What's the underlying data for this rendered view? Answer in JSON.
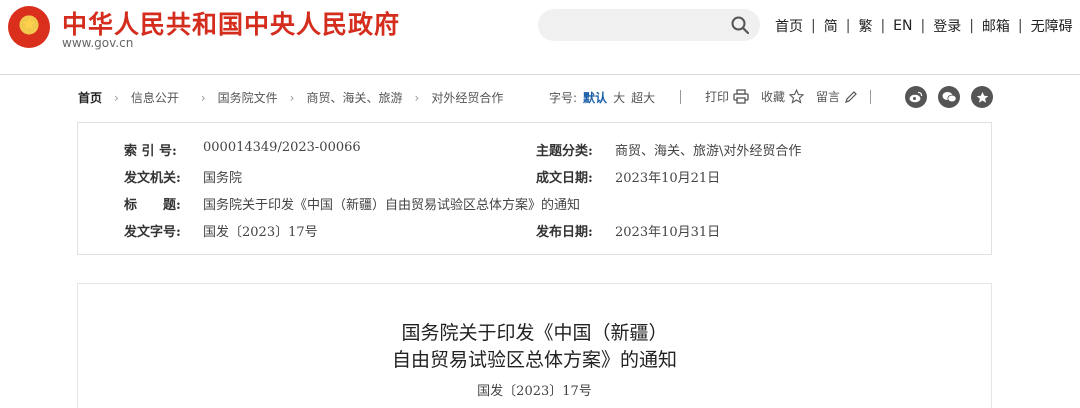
{
  "header": {
    "site_name": "中华人民共和国中央人民政府",
    "site_url": "www.gov.cn",
    "nav": [
      "首页",
      "简",
      "繁",
      "EN",
      "登录",
      "邮箱",
      "无障碍"
    ],
    "nav_separator": "|",
    "search_placeholder": ""
  },
  "breadcrumb": {
    "items": [
      "首页",
      "信息公开",
      "国务院文件",
      "商贸、海关、旅游",
      "对外经贸合作"
    ],
    "arrow": "›"
  },
  "font_size": {
    "label": "字号:",
    "options": [
      "默认",
      "大",
      "超大"
    ],
    "selected": "默认"
  },
  "tools": {
    "print": "打印",
    "favorite": "收藏",
    "comment": "留言"
  },
  "share_icons": [
    "weibo-icon",
    "wechat-icon",
    "star-share-icon"
  ],
  "meta": {
    "index_label": "索 引 号:",
    "index_value": "000014349/2023-00066",
    "topic_label": "主题分类:",
    "topic_value": "商贸、海关、旅游\\对外经贸合作",
    "issuer_label": "发文机关:",
    "issuer_value": "国务院",
    "written_label": "成文日期:",
    "written_value": "2023年10月21日",
    "title_label": "标　　题:",
    "title_value": "国务院关于印发《中国（新疆）自由贸易试验区总体方案》的通知",
    "docno_label": "发文字号:",
    "docno_value": "国发〔2023〕17号",
    "published_label": "发布日期:",
    "published_value": "2023年10月31日"
  },
  "article": {
    "title_line1": "国务院关于印发《中国（新疆）",
    "title_line2": "自由贸易试验区总体方案》的通知",
    "doc_number": "国发〔2023〕17号"
  },
  "colors": {
    "brand_red": "#d42d1e",
    "link_blue": "#1a5ea8",
    "icon_gray": "#555555"
  }
}
